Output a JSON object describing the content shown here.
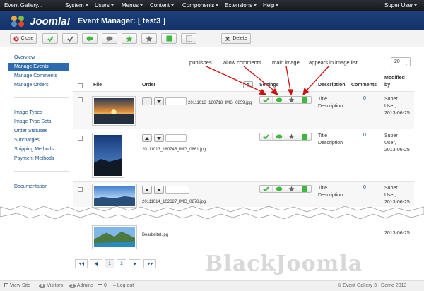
{
  "navbar": {
    "site": "Event Gallery...",
    "menus": [
      "System",
      "Users",
      "Menus",
      "Content",
      "Components",
      "Extensions",
      "Help"
    ],
    "user": "Super User"
  },
  "header": {
    "logo_text": "Joomla!",
    "title": "Event Manager: [ test3 ]"
  },
  "toolbar": {
    "close": "Close",
    "delete": "Delete"
  },
  "sidebar": {
    "group1": [
      "Overview",
      "Manage Events",
      "Manage Comments",
      "Manage Orders"
    ],
    "group2": [
      "Image Types",
      "Image Type Sets",
      "Order Statuses",
      "Surcharges",
      "Shipping Methods",
      "Payment Methods"
    ],
    "group3": [
      "Documentation"
    ]
  },
  "annotations": {
    "a1": "publishes",
    "a2": "allow comments",
    "a3": "main image",
    "a4": "appears in image list"
  },
  "list_limit": "20",
  "table": {
    "headers": {
      "file": "File",
      "order": "Order",
      "settings": "Settings",
      "description": "Description",
      "comments": "Comments",
      "modified": "Modified",
      "by": "by"
    },
    "rows": [
      {
        "file": "20111013_180718_IMG_0859.jpg",
        "desc1": "Title",
        "desc2": "Description",
        "comments": "0",
        "mod1": "Super",
        "mod2": "User,",
        "mod3": "2013-06-25"
      },
      {
        "file": "20111013_180745_IMG_0861.jpg",
        "desc1": "Title",
        "desc2": "Description",
        "comments": "0",
        "mod1": "Super",
        "mod2": "User,",
        "mod3": "2013-06-25"
      },
      {
        "file": "20111014_102627_IMG_0878.jpg",
        "desc1": "Title",
        "desc2": "Description",
        "comments": "0",
        "mod1": "Super",
        "mod2": "User,",
        "mod3": "2013-06-25"
      },
      {
        "file": "Bearbeitet.jpg",
        "desc1": "",
        "desc2": "",
        "comments": "",
        "mod1": "",
        "mod2": "",
        "mod3": "2013-06-25"
      }
    ]
  },
  "pagination": {
    "p1": "1",
    "p2": "2"
  },
  "watermark": "BlackJoomla",
  "footer": {
    "view_site": "View Site",
    "visitors_count": "0",
    "visitors": "Visitors",
    "admins_count": "1",
    "admins": "Admins",
    "msgs": "0",
    "logout": "Log out",
    "copyright": "© Event Gallery 3 - Demo 2013"
  },
  "colors": {
    "navbar": "#1f2226",
    "header": "#1b3f7a",
    "active": "#2d6bb0",
    "green": "#3cb83c",
    "arrow": "#cc1111"
  }
}
